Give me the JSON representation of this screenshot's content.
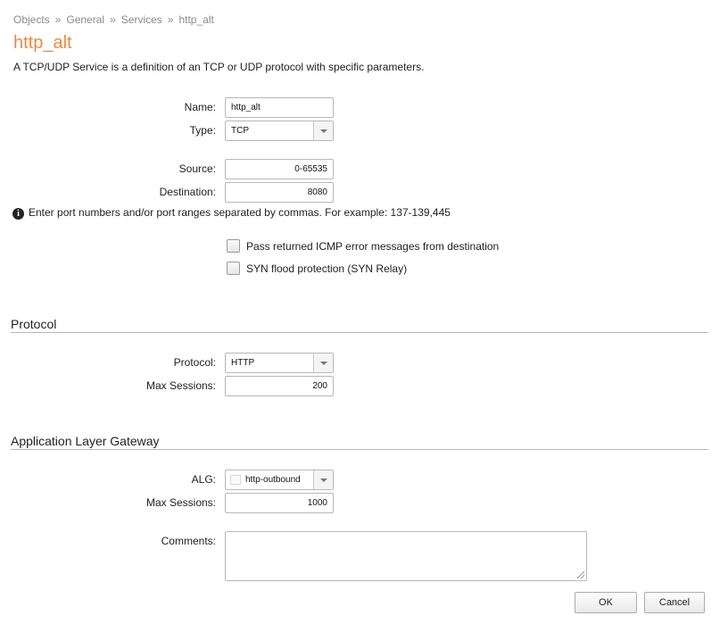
{
  "breadcrumb": [
    "Objects",
    "General",
    "Services",
    "http_alt"
  ],
  "breadcrumb_separator": "»",
  "title": "http_alt",
  "description": "A TCP/UDP Service is a definition of an TCP or UDP protocol with specific parameters.",
  "form": {
    "name_label": "Name:",
    "name_value": "http_alt",
    "type_label": "Type:",
    "type_value": "TCP",
    "source_label": "Source:",
    "source_value": "0-65535",
    "destination_label": "Destination:",
    "destination_value": "8080",
    "info_icon": "i",
    "info_text": "Enter port numbers and/or port ranges separated by commas. For example: 137-139,445",
    "icmp_label": "Pass returned ICMP error messages from destination",
    "icmp_checked": false,
    "syn_label": "SYN flood protection (SYN Relay)",
    "syn_checked": false
  },
  "protocol_section": {
    "title": "Protocol",
    "protocol_label": "Protocol:",
    "protocol_value": "HTTP",
    "max_sessions_label": "Max Sessions:",
    "max_sessions_value": "200"
  },
  "alg_section": {
    "title": "Application Layer Gateway",
    "alg_label": "ALG:",
    "alg_value": "http-outbound",
    "max_sessions_label": "Max Sessions:",
    "max_sessions_value": "1000",
    "comments_label": "Comments:",
    "comments_value": ""
  },
  "buttons": {
    "ok": "OK",
    "cancel": "Cancel"
  }
}
